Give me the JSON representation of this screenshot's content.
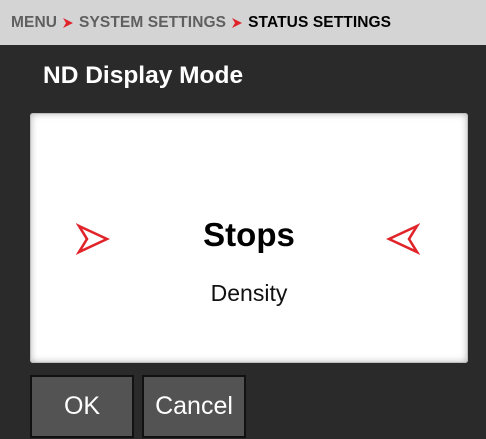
{
  "breadcrumb": {
    "items": [
      "MENU",
      "SYSTEM SETTINGS",
      "STATUS SETTINGS"
    ],
    "separator_icon": "chevron-right-icon"
  },
  "title": "ND Display Mode",
  "selector": {
    "selected": "Stops",
    "next_option": "Density",
    "left_icon": "arrow-right-outline-icon",
    "right_icon": "arrow-left-outline-icon"
  },
  "buttons": {
    "ok": "OK",
    "cancel": "Cancel"
  },
  "colors": {
    "accent": "#e0242a",
    "header_bg": "#d4d4d4",
    "background": "#2a2a2a",
    "button_bg": "#535353"
  }
}
